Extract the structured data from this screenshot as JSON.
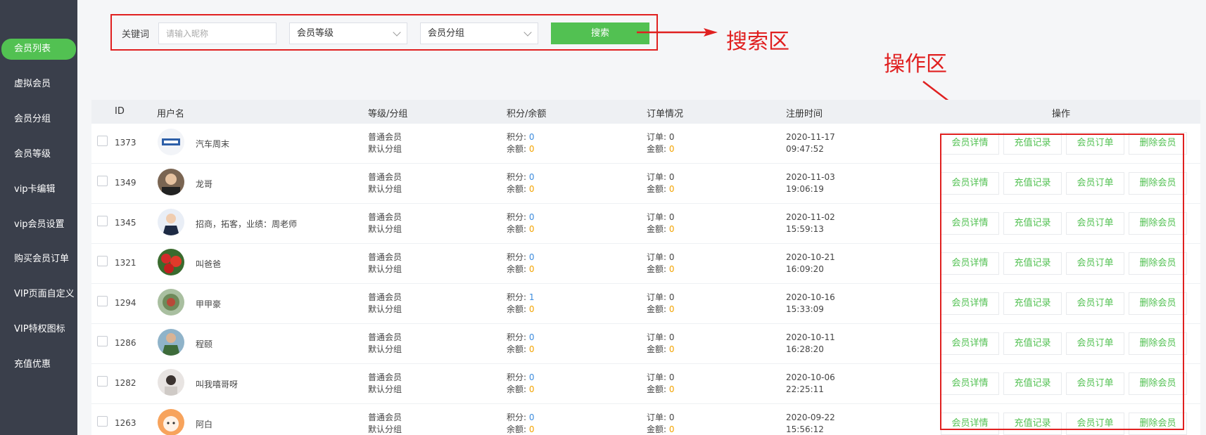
{
  "sidebar": {
    "items": [
      {
        "label": "会员列表",
        "active": true
      },
      {
        "label": "虚拟会员"
      },
      {
        "label": "会员分组"
      },
      {
        "label": "会员等级"
      },
      {
        "label": "vip卡编辑"
      },
      {
        "label": "vip会员设置"
      },
      {
        "label": "购买会员订单"
      },
      {
        "label": "VIP页面自定义"
      },
      {
        "label": "VIP特权图标"
      },
      {
        "label": "充值优惠"
      }
    ]
  },
  "search": {
    "keyword_label": "关键词",
    "keyword_placeholder": "请输入昵称",
    "level_select": "会员等级",
    "group_select": "会员分组",
    "search_button": "搜索"
  },
  "annotations": {
    "search_area": "搜索区",
    "operation_area": "操作区"
  },
  "table": {
    "headers": {
      "id": "ID",
      "username": "用户名",
      "level_group": "等级/分组",
      "points_balance": "积分/余额",
      "orders": "订单情况",
      "reg_time": "注册时间",
      "actions": "操作"
    },
    "labels": {
      "points": "积分: ",
      "balance": "余额: ",
      "orders": "订单: ",
      "amount": "金额: "
    },
    "actions": [
      "会员详情",
      "充值记录",
      "会员订单",
      "删除会员"
    ],
    "rows": [
      {
        "id": "1373",
        "name": "汽车周末",
        "level": "普通会员",
        "group": "默认分组",
        "points": "0",
        "balance": "0",
        "orders": "0",
        "amount": "0",
        "date": "2020-11-17",
        "time": "09:47:52",
        "avatar": "car-logo-avatar"
      },
      {
        "id": "1349",
        "name": "龙哥",
        "level": "普通会员",
        "group": "默认分组",
        "points": "0",
        "balance": "0",
        "orders": "0",
        "amount": "0",
        "date": "2020-11-03",
        "time": "19:06:19",
        "avatar": "man-photo-avatar"
      },
      {
        "id": "1345",
        "name": "招商，拓客，业绩：周老师",
        "level": "普通会员",
        "group": "默认分组",
        "points": "0",
        "balance": "0",
        "orders": "0",
        "amount": "0",
        "date": "2020-11-02",
        "time": "15:59:13",
        "avatar": "suit-man-avatar"
      },
      {
        "id": "1321",
        "name": "叫爸爸",
        "level": "普通会员",
        "group": "默认分组",
        "points": "0",
        "balance": "0",
        "orders": "0",
        "amount": "0",
        "date": "2020-10-21",
        "time": "16:09:20",
        "avatar": "red-flowers-avatar"
      },
      {
        "id": "1294",
        "name": "甲甲豪",
        "level": "普通会员",
        "group": "默认分组",
        "points": "1",
        "balance": "0",
        "orders": "0",
        "amount": "0",
        "date": "2020-10-16",
        "time": "15:33:09",
        "avatar": "plant-avatar"
      },
      {
        "id": "1286",
        "name": "程颐",
        "level": "普通会员",
        "group": "默认分组",
        "points": "0",
        "balance": "0",
        "orders": "0",
        "amount": "0",
        "date": "2020-10-11",
        "time": "16:28:20",
        "avatar": "green-shirt-avatar"
      },
      {
        "id": "1282",
        "name": "叫我嘻哥呀",
        "level": "普通会员",
        "group": "默认分组",
        "points": "0",
        "balance": "0",
        "orders": "0",
        "amount": "0",
        "date": "2020-10-06",
        "time": "22:25:11",
        "avatar": "pale-photo-avatar"
      },
      {
        "id": "1263",
        "name": "阿白",
        "level": "普通会员",
        "group": "默认分组",
        "points": "0",
        "balance": "0",
        "orders": "0",
        "amount": "0",
        "date": "2020-09-22",
        "time": "15:56:12",
        "avatar": "cartoon-dog-avatar"
      }
    ]
  },
  "colors": {
    "accent": "#52c152",
    "sidebar_bg": "#3a3f4b",
    "annotation": "#e02020",
    "link_blue": "#3b8bdd",
    "balance_orange": "#f3a300"
  }
}
